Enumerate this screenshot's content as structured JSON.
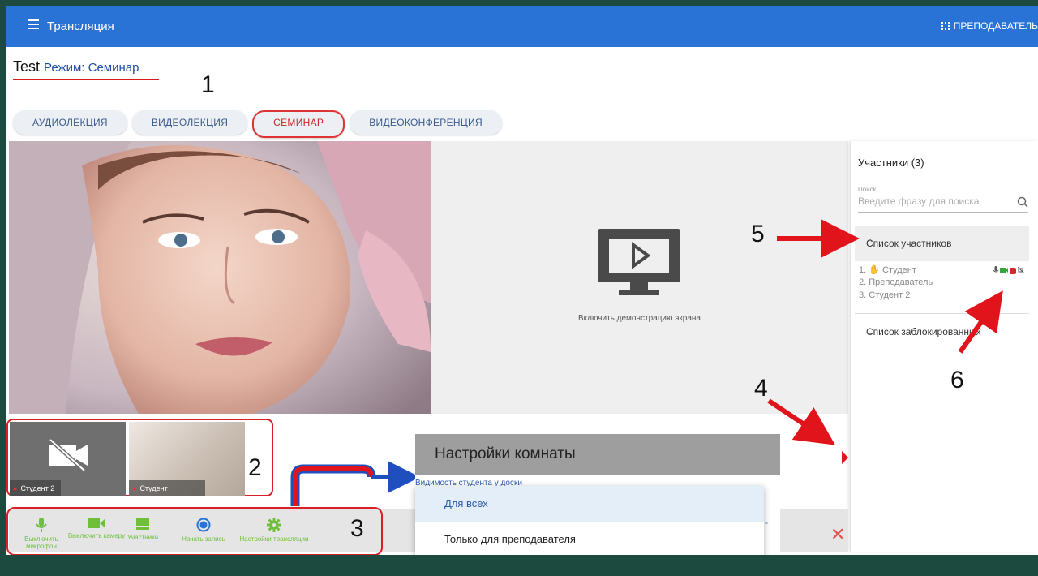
{
  "topbar": {
    "title": "Трансляция",
    "right_label": "ПРЕПОДАВАТЕЛЬ"
  },
  "room": {
    "name": "Test",
    "mode_label": "Режим: Семинар"
  },
  "callouts": [
    "1",
    "2",
    "3",
    "4",
    "5",
    "6"
  ],
  "modes": [
    {
      "label": "АУДИОЛЕКЦИЯ",
      "active": false
    },
    {
      "label": "ВИДЕОЛЕКЦИЯ",
      "active": false
    },
    {
      "label": "СЕМИНАР",
      "active": true
    },
    {
      "label": "ВИДЕОКОНФЕРЕНЦИЯ",
      "active": false
    }
  ],
  "screen_share": {
    "text": "Включить демонстрацию экрана",
    "icon": "monitor-play-icon"
  },
  "participants_panel": {
    "title": "Участники (3)",
    "search_label": "Поиск",
    "search_placeholder": "Введите фразу для поиска",
    "list_header": "Список участников",
    "participants": [
      {
        "num": "1.",
        "name": "Студент",
        "hand_raised": true
      },
      {
        "num": "2.",
        "name": "Преподаватель"
      },
      {
        "num": "3.",
        "name": "Студент 2"
      }
    ],
    "blocked_header": "Список заблокированных"
  },
  "thumbnails": [
    {
      "name": "Студент 2",
      "camera_off": true
    },
    {
      "name": "Студент",
      "camera_off": false
    }
  ],
  "toolbar": [
    {
      "label": "Выключить микрофон",
      "icon": "microphone-icon"
    },
    {
      "label": "Выключить камеру",
      "icon": "camera-icon"
    },
    {
      "label": "Участники",
      "icon": "list-icon"
    },
    {
      "label": "Начать запись",
      "icon": "record-icon"
    },
    {
      "label": "Настройки трансляции",
      "icon": "gear-icon"
    }
  ],
  "room_settings": {
    "title": "Настройки комнаты",
    "visibility_label": "Видимость студента у доски",
    "options": [
      "Для всех",
      "Только для преподавателя"
    ],
    "selected": "Для всех",
    "trailing_char": "ь"
  },
  "colors": {
    "topbar": "#2a73d6",
    "accent_red": "#d81f26",
    "toolbar_green": "#6fbf3a",
    "background": "#1d4a3f"
  }
}
